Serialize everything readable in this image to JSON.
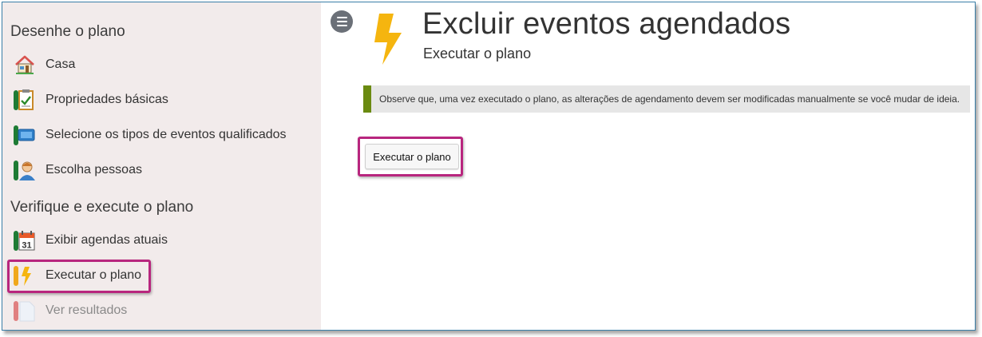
{
  "sidebar": {
    "section1_title": "Desenhe o plano",
    "section2_title": "Verifique e execute o plano",
    "items": [
      {
        "label": "Casa",
        "icon": "home-icon"
      },
      {
        "label": "Propriedades básicas",
        "icon": "clipboard-check-icon"
      },
      {
        "label": "Selecione os tipos de eventos qualificados",
        "icon": "monitor-icon"
      },
      {
        "label": "Escolha pessoas",
        "icon": "person-icon"
      },
      {
        "label": "Exibir agendas atuais",
        "icon": "calendar-icon",
        "calendar_day": "31"
      },
      {
        "label": "Executar o plano",
        "icon": "lightning-icon"
      },
      {
        "label": "Ver resultados",
        "icon": "document-icon"
      }
    ]
  },
  "main": {
    "title": "Excluir eventos agendados",
    "subtitle": "Executar o plano",
    "notice": "Observe que, uma vez executado o plano, as alterações de agendamento devem ser modificadas manualmente se você mudar de ideia.",
    "run_button_label": "Executar o plano"
  },
  "colors": {
    "sidebar_bg": "#f2ebeb",
    "highlight": "#b8267e",
    "notice_bar": "#6a8a10",
    "tab_green": "#1e7b34",
    "tab_orange": "#f0a81c",
    "tab_red": "#e08080",
    "lightning": "#f5b50f"
  }
}
